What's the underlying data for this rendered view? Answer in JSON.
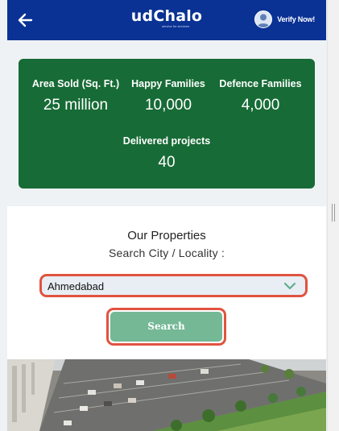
{
  "header": {
    "logo": "udChalo",
    "logo_tagline": "service for services",
    "verify_label": "Verify Now!"
  },
  "stats": [
    {
      "label": "Area Sold (Sq. Ft.)",
      "value": "25 million"
    },
    {
      "label": "Happy Families",
      "value": "10,000"
    },
    {
      "label": "Defence Families",
      "value": "4,000"
    },
    {
      "label": "Delivered projects",
      "value": "40"
    }
  ],
  "properties": {
    "title": "Our Properties",
    "search_label": "Search City / Locality :",
    "selected_city": "Ahmedabad",
    "search_button": "Search"
  },
  "colors": {
    "header": "#0a3294",
    "stats_card": "#176b36",
    "search_button": "#74b896",
    "highlight": "#e0533f"
  },
  "icons": {
    "back": "arrow-left-icon",
    "avatar": "user-avatar-icon",
    "dropdown": "chevron-down-icon"
  }
}
